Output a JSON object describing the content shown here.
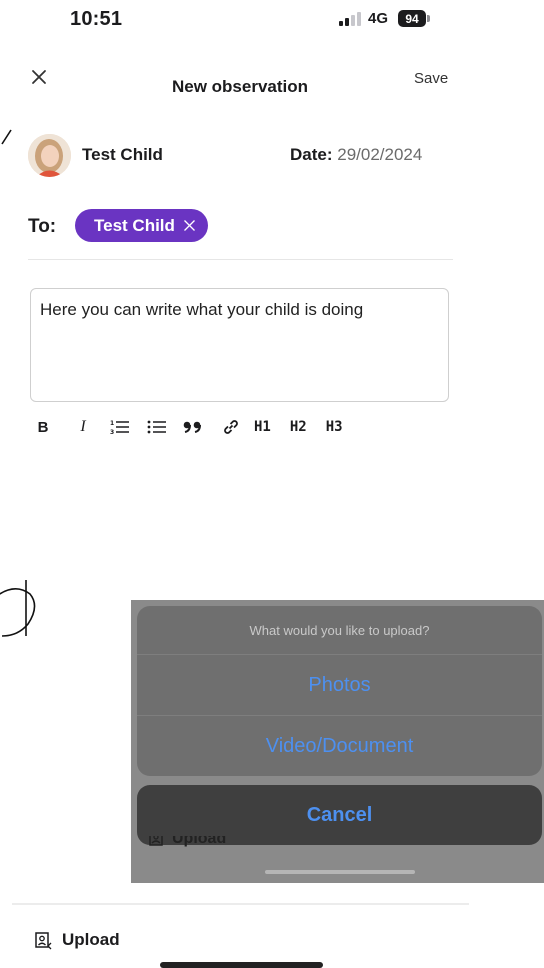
{
  "status_bar": {
    "time": "10:51",
    "network": "4G",
    "battery": "94"
  },
  "header": {
    "title": "New observation",
    "save_label": "Save"
  },
  "child": {
    "name": "Test Child",
    "date_label": "Date:",
    "date_value": "29/02/2024"
  },
  "recipients": {
    "label": "To:",
    "chips": [
      "Test Child"
    ]
  },
  "editor": {
    "text": "Here you can write what your child is doing"
  },
  "toolbar": {
    "h1": "H1",
    "h2": "H2",
    "h3": "H3"
  },
  "action_sheet": {
    "prompt": "What would you like to upload?",
    "options": [
      "Photos",
      "Video/Document"
    ],
    "cancel": "Cancel",
    "background_label": "Upload"
  },
  "footer": {
    "upload_label": "Upload"
  },
  "colors": {
    "chip": "#6a34c2",
    "sheet_action": "#4d90f0"
  }
}
